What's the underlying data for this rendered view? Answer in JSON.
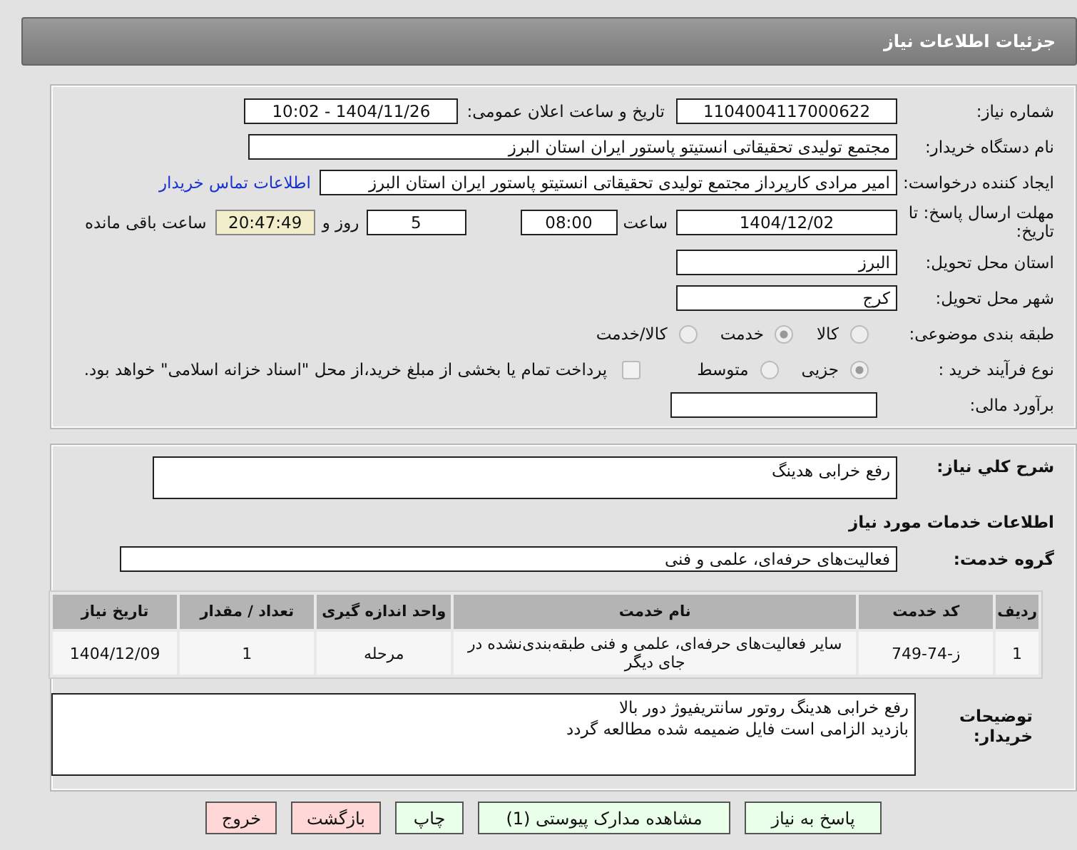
{
  "header": {
    "title": "جزئیات اطلاعات نیاز"
  },
  "need_number": {
    "label": "شماره نیاز:",
    "value": "1104004117000622"
  },
  "announce": {
    "label": "تاریخ و ساعت اعلان عمومی:",
    "value": "1404/11/26 - 10:02"
  },
  "buyer_org": {
    "label": "نام دستگاه خریدار:",
    "value": "مجتمع تولیدی تحقیقاتی انستیتو پاستور ایران استان البرز"
  },
  "requester": {
    "label": "ایجاد کننده درخواست:",
    "value": "امیر مرادی کارپرداز مجتمع تولیدی تحقیقاتی انستیتو پاستور ایران استان البرز",
    "link": "اطلاعات تماس خریدار"
  },
  "deadline": {
    "label": "مهلت ارسال پاسخ: تا تاریخ:",
    "date": "1404/12/02",
    "time_label": "ساعت",
    "time": "08:00",
    "days": "5",
    "days_label": "روز و",
    "remaining": "20:47:49",
    "remaining_label": "ساعت باقی مانده"
  },
  "province": {
    "label": "استان محل تحویل:",
    "value": "البرز"
  },
  "city": {
    "label": "شهر محل تحویل:",
    "value": "کرج"
  },
  "classification": {
    "label": "طبقه بندی موضوعی:",
    "options": [
      {
        "label": "کالا",
        "selected": false
      },
      {
        "label": "خدمت",
        "selected": true
      },
      {
        "label": "کالا/خدمت",
        "selected": false
      }
    ]
  },
  "process": {
    "label": "نوع فرآیند خرید :",
    "options": [
      {
        "label": "جزیی",
        "selected": true
      },
      {
        "label": "متوسط",
        "selected": false
      }
    ],
    "payment_checkbox": {
      "checked": false,
      "text": "پرداخت تمام یا بخشی از مبلغ خرید،از محل \"اسناد خزانه اسلامی\" خواهد بود."
    }
  },
  "estimate": {
    "label": "برآورد مالی:"
  },
  "description": {
    "label": "شرح کلي نياز:",
    "value": "رفع خرابی هدینگ"
  },
  "services_heading": "اطلاعات خدمات مورد نیاز",
  "service_group": {
    "label": "گروه خدمت:",
    "value": "فعالیت‌های حرفه‌ای، علمی و فنی"
  },
  "table": {
    "columns": [
      "ردیف",
      "کد خدمت",
      "نام خدمت",
      "واحد اندازه گیری",
      "تعداد / مقدار",
      "تاریخ نیاز"
    ],
    "rows": [
      [
        "1",
        "ز-74-749",
        "سایر فعالیت‌های حرفه‌ای، علمی و فنی طبقه‌بندی‌نشده در جای دیگر",
        "مرحله",
        "1",
        "1404/12/09"
      ]
    ]
  },
  "buyer_notes": {
    "label": "توضیحات خریدار:",
    "lines": [
      "رفع خرابی هدینگ روتور سانتریفیوژ دور بالا",
      "بازدید الزامی است فایل ضمیمه شده مطالعه گردد"
    ]
  },
  "buttons": [
    {
      "label": "پاسخ به نیاز",
      "kind": "primary"
    },
    {
      "label": "مشاهده مدارک پیوستی (1)",
      "kind": "primary"
    },
    {
      "label": "چاپ",
      "kind": "primary"
    },
    {
      "label": "بازگشت",
      "kind": "danger"
    },
    {
      "label": "خروج",
      "kind": "danger"
    }
  ]
}
